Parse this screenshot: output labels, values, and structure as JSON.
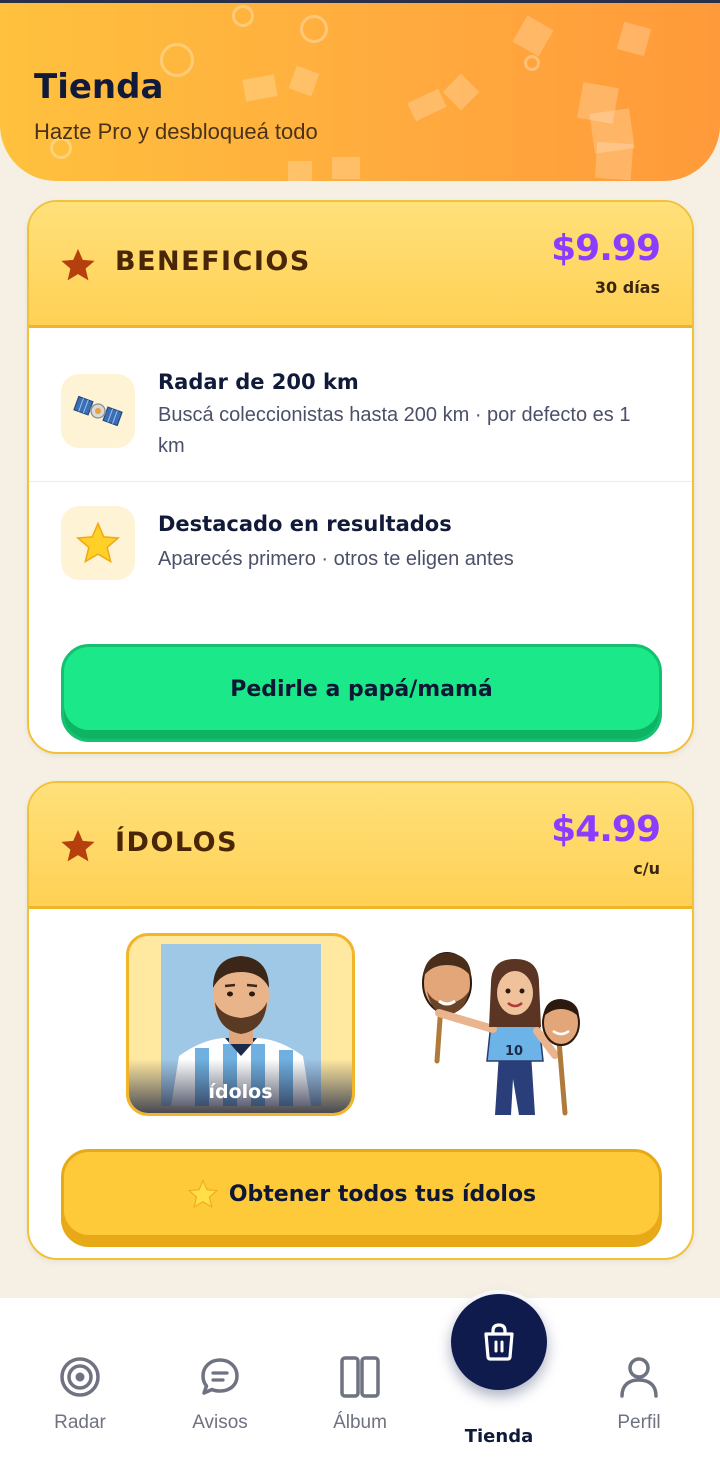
{
  "header": {
    "title": "Tienda",
    "subtitle": "Hazte Pro y desbloqueá todo"
  },
  "beneficios": {
    "title": "BENEFICIOS",
    "price": "$9.99",
    "price_note": "30 días",
    "features": [
      {
        "icon": "satellite-icon",
        "title": "Radar de 200 km",
        "description": "Buscá coleccionistas hasta 200 km · por defecto es 1 km"
      },
      {
        "icon": "star-icon",
        "title": "Destacado en resultados",
        "description": "Aparecés primero · otros te eligen antes"
      }
    ],
    "button_label": "Pedirle a papá/mamá"
  },
  "idolos": {
    "title": "ÍDOLOS",
    "price": "$4.99",
    "price_note": "c/u",
    "image_label": "ídolos",
    "button_label": "Obtener todos tus ídolos"
  },
  "nav": {
    "items": [
      {
        "label": "Radar",
        "icon": "radar-icon"
      },
      {
        "label": "Avisos",
        "icon": "chat-icon"
      },
      {
        "label": "Álbum",
        "icon": "album-icon"
      },
      {
        "label": "Tienda",
        "icon": "shopping-bag-icon",
        "active": true
      },
      {
        "label": "Perfil",
        "icon": "user-icon"
      }
    ]
  },
  "colors": {
    "accent_price": "#8b3dff",
    "header_orange": "#ffab3e",
    "card_yellow": "#ffd155",
    "button_green": "#1be889",
    "button_yellow": "#ffca3a",
    "nav_active_bg": "#0f1b4d"
  }
}
